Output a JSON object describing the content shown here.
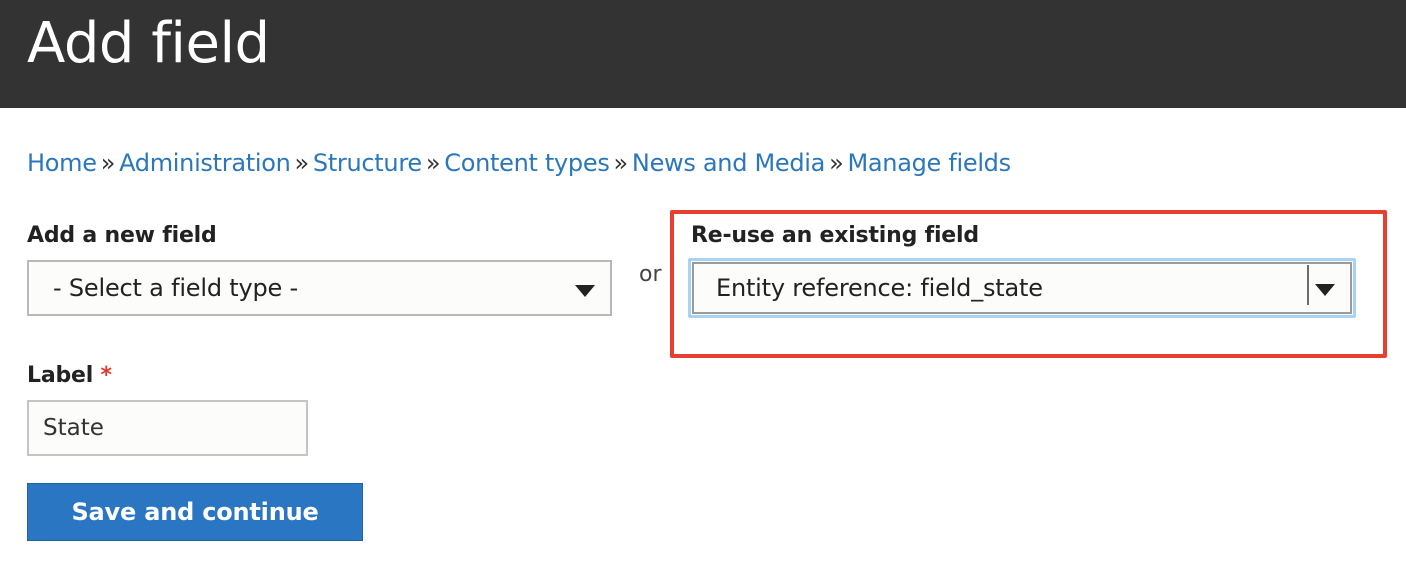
{
  "header": {
    "title": "Add field"
  },
  "breadcrumb": {
    "items": [
      "Home",
      "Administration",
      "Structure",
      "Content types",
      "News and Media",
      "Manage fields"
    ],
    "separator": "»"
  },
  "new_field": {
    "label": "Add a new field",
    "select_value": "- Select a field type -"
  },
  "or_text": "or",
  "existing_field": {
    "label": "Re-use an existing field",
    "select_value": "Entity reference: field_state"
  },
  "label_field": {
    "label": "Label",
    "required_marker": "*",
    "value": "State"
  },
  "actions": {
    "save_label": "Save and continue"
  },
  "colors": {
    "header_bg": "#333333",
    "link": "#2b77bc",
    "highlight": "#e8402f",
    "button": "#2b76c3",
    "required": "#e23b2c"
  }
}
